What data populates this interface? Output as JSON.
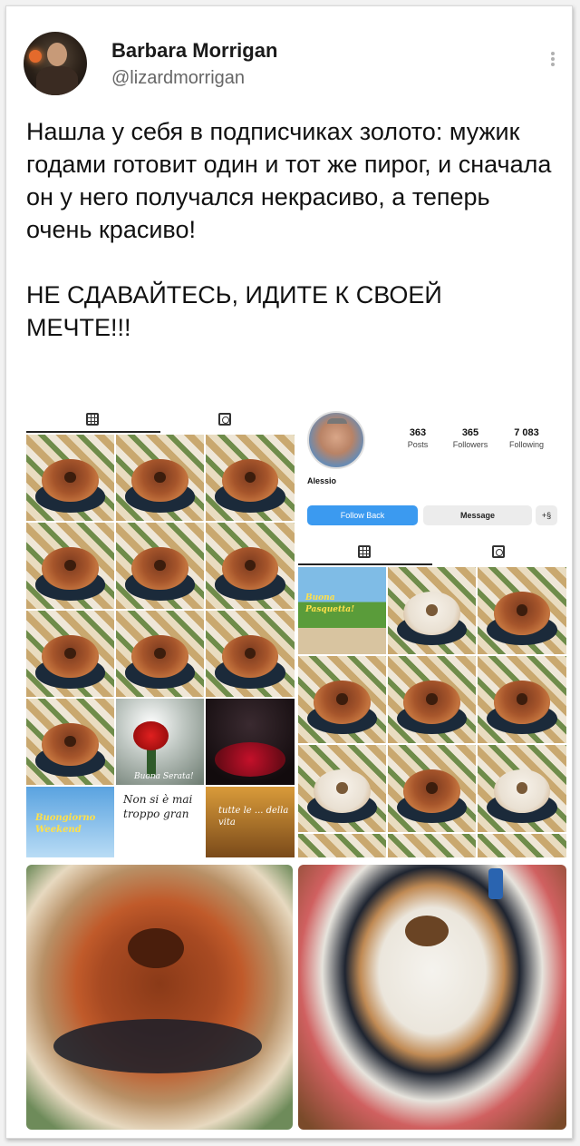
{
  "tweet": {
    "author_name": "Barbara Morrigan",
    "author_handle": "@lizardmorrigan",
    "body": "Нашла у себя в подписчиках золото: мужик годами готовит один и тот же пирог, и сначала он у него получался некрасиво, а теперь очень красиво!\n\nНЕ СДАВАЙТЕСЬ, ИДИТЕ К СВОЕЙ МЕЧТЕ!!!"
  },
  "profile": {
    "name": "Alessio",
    "stats": [
      {
        "value": "363",
        "label": "Posts"
      },
      {
        "value": "365",
        "label": "Followers"
      },
      {
        "value": "7 083",
        "label": "Following"
      }
    ],
    "follow_back_label": "Follow Back",
    "message_label": "Message",
    "add_user_icon": "+§"
  },
  "overlays": {
    "non_si": "Non si è mai troppo gran",
    "tutte": "tutte le ... della vita",
    "buona_pasquetta": "Buona Pasquetta!",
    "buongiorno": "Buongiorno Weekend",
    "buona_serata": "Buona Serata!"
  },
  "icons": {
    "grid": "grid-icon",
    "tagged": "tagged-icon",
    "more": "more-vertical-icon"
  }
}
